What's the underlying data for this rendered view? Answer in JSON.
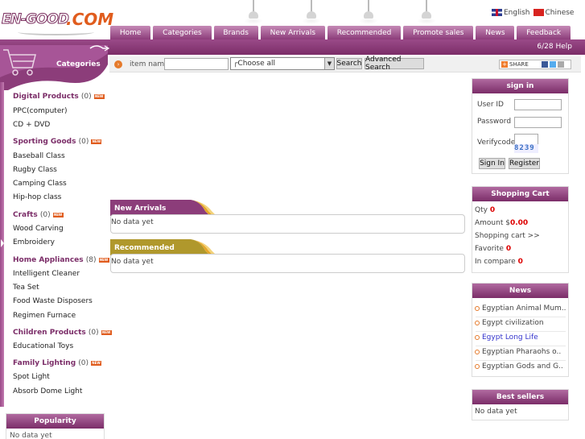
{
  "logo": {
    "part1": "EN-GOOD",
    "part2": ".COM"
  },
  "lang": {
    "english": "English",
    "chinese": "Chinese"
  },
  "nav": [
    "Home",
    "Categories",
    "Brands",
    "New Arrivals",
    "Recommended",
    "Promote sales",
    "News",
    "Feedback"
  ],
  "date_help": "6/28 Help",
  "sidebar_title": "Categories",
  "search": {
    "label": "item name",
    "value": "",
    "select": "┌Choose all",
    "button": "Search",
    "advanced": "Advanced Search"
  },
  "share": {
    "label": "SHARE"
  },
  "categories": [
    {
      "name": "Digital Products",
      "count": "(0)",
      "subs": [
        "PPC(computer)",
        "CD + DVD"
      ]
    },
    {
      "name": "Sporting Goods",
      "count": "(0)",
      "subs": [
        "Baseball Class",
        "Rugby Class",
        "Camping Class",
        "Hip-hop class"
      ]
    },
    {
      "name": "Crafts",
      "count": "(0)",
      "subs": [
        "Wood Carving",
        "Embroidery"
      ]
    },
    {
      "name": "Home Appliances",
      "count": "(8)",
      "subs": [
        "Intelligent Cleaner",
        "Tea Set",
        "Food Waste Disposers",
        "Regimen Furnace"
      ]
    },
    {
      "name": "Children Products",
      "count": "(0)",
      "subs": [
        "Educational Toys"
      ]
    },
    {
      "name": "Family Lighting",
      "count": "(0)",
      "subs": [
        "Spot Light",
        "Absorb Dome Light"
      ]
    }
  ],
  "badge": "NEW",
  "popularity": {
    "title": "Popularity",
    "text": "No data yet"
  },
  "new_arrivals": {
    "title": "New Arrivals",
    "text": "No data yet"
  },
  "recommended": {
    "title": "Recommended",
    "text": "No data yet"
  },
  "signin": {
    "title": "sign in",
    "userid": "User ID",
    "password": "Password",
    "verifycode": "Verifycode",
    "captcha": "8239",
    "signin_btn": "Sign In",
    "register_btn": "Register"
  },
  "cart": {
    "title": "Shopping Cart",
    "qty_label": "Qty",
    "qty": "0",
    "amount_label": "Amount $",
    "amount": "0.00",
    "cart_link": "Shopping cart >>",
    "fav_label": "Favorite",
    "fav": "0",
    "compare_label": "In compare",
    "compare": "0"
  },
  "news": {
    "title": "News",
    "items": [
      "Egyptian Animal Mum..",
      "Egypt civilization",
      "Egypt Long Life",
      "Egyptian Pharaohs o..",
      "Egyptian Gods and G.."
    ]
  },
  "bestsellers": {
    "title": "Best sellers",
    "text": "No data yet"
  },
  "colors": {
    "brand_purple": "#7b2d68",
    "accent_orange": "#e05c1d",
    "highlight_link": "#3333cc"
  }
}
